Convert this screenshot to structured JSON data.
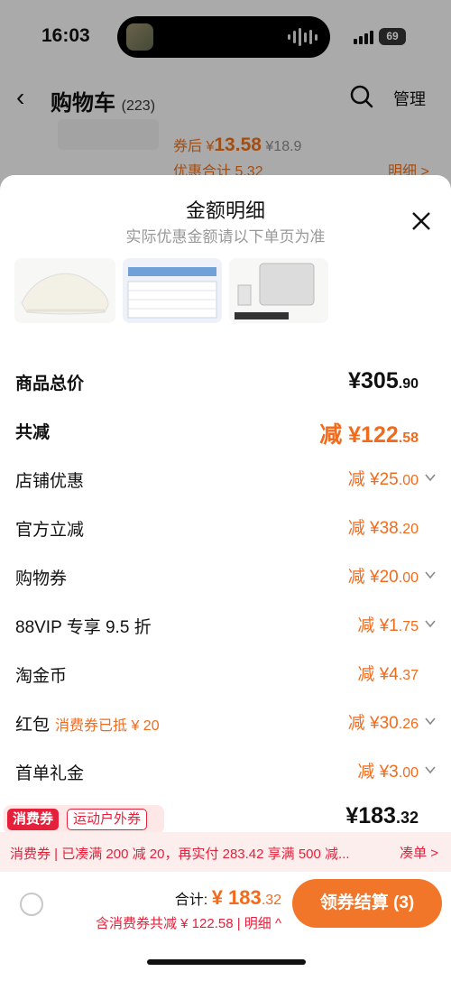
{
  "status_bar": {
    "time": "16:03",
    "battery": "69"
  },
  "nav": {
    "back": "‹",
    "title": "购物车",
    "count": "(223)",
    "manage": "管理"
  },
  "background_item": {
    "after_label": "券后",
    "price_symbol": "¥",
    "price": "13.58",
    "orig_price": "¥18.9",
    "discount_total": "优惠合计 5.32",
    "detail": "明细 >"
  },
  "sheet": {
    "title": "金额明细",
    "subtitle": "实际优惠金额请以下单页为准",
    "rows": [
      {
        "label": "商品总价",
        "value": "¥305",
        "dec": ".90"
      },
      {
        "label": "共减",
        "value": "减 ¥122",
        "dec": ".58"
      },
      {
        "label": "店铺优惠",
        "value": "减 ¥25",
        "dec": ".00"
      },
      {
        "label": "官方立减",
        "value": "减 ¥38",
        "dec": ".20"
      },
      {
        "label": "购物券",
        "value": "减 ¥20",
        "dec": ".00"
      },
      {
        "label": "88VIP 专享 9.5 折",
        "value": "减 ¥1",
        "dec": ".75"
      },
      {
        "label": "淘金币",
        "value": "减 ¥4",
        "dec": ".37"
      },
      {
        "label": "红包",
        "tag": "消费券已抵 ¥ 20",
        "value": "减 ¥30",
        "dec": ".26"
      },
      {
        "label": "首单礼金",
        "value": "减 ¥3",
        "dec": ".00"
      }
    ],
    "coupon_tags": [
      "消费券",
      "运动户外券"
    ],
    "final": {
      "value": "¥183",
      "dec": ".32"
    }
  },
  "strip": {
    "text": "消费券 | 已凑满 200 减 20，再实付 283.42 享满 500 减...",
    "action": "凑单 >"
  },
  "bottom": {
    "total_label": "合计:",
    "total_value": "¥ 183",
    "total_dec": ".32",
    "sub": "含消费券共减 ¥ 122.58 | 明细 ^",
    "pay_button": "领券结算 (3)"
  },
  "colors": {
    "accent": "#f27629",
    "red": "#e5203a"
  }
}
